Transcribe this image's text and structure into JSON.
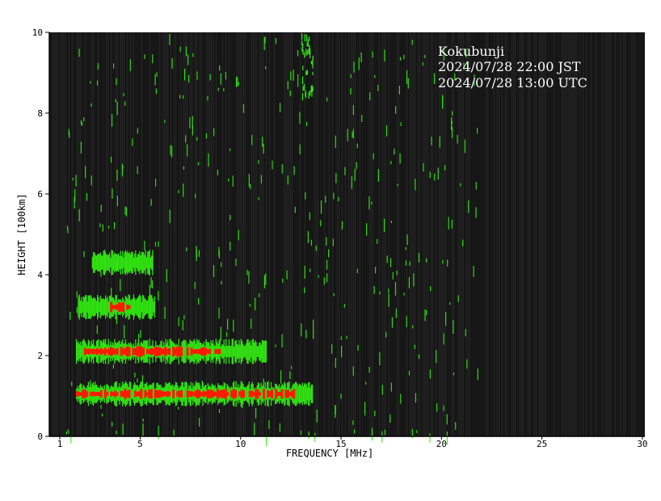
{
  "chart_data": {
    "type": "heatmap",
    "xlabel": "FREQUENCY [MHz]",
    "ylabel": "HEIGHT [100km]",
    "xlim": [
      0,
      30
    ],
    "ylim": [
      0,
      10
    ],
    "xticks": [
      "1",
      "5",
      "10",
      "15",
      "20",
      "25",
      "30"
    ],
    "xtick_values": [
      1,
      5,
      10,
      15,
      20,
      25,
      30
    ],
    "yticks": [
      "0",
      "2",
      "4",
      "6",
      "8",
      "10"
    ],
    "ytick_values": [
      0,
      2,
      4,
      6,
      8,
      10
    ],
    "annotation": {
      "station": "Kokubunji",
      "jst": "2024/07/28 22:00 JST",
      "utc": "2024/07/28 13:00 UTC"
    },
    "colors": {
      "background": "#1a1a1a",
      "echo": "#33ee11",
      "strong_echo": "#ff1a00"
    },
    "echo_traces": [
      {
        "band": 1,
        "height": 1.05,
        "f_start": 1.8,
        "f_end": 13.6,
        "strong_f_start": 1.8,
        "strong_f_end": 12.6
      },
      {
        "band": 2,
        "height": 2.1,
        "f_start": 1.8,
        "f_end": 11.3,
        "strong_f_start": 2.2,
        "strong_f_end": 9.0
      },
      {
        "band": 3,
        "height": 3.2,
        "f_start": 1.9,
        "f_end": 5.7,
        "strong_f_start": 3.5,
        "strong_f_end": 4.4
      },
      {
        "band": 4,
        "height": 4.3,
        "f_start": 2.6,
        "f_end": 5.6,
        "strong_f_start": null,
        "strong_f_end": null
      }
    ]
  }
}
